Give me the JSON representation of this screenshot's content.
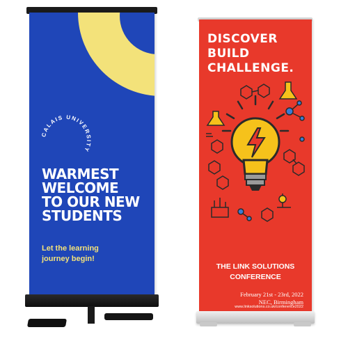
{
  "left_banner": {
    "university_ring": "CALAIS UNIVERSITY",
    "headline": [
      "WARMEST",
      "WELCOME",
      "TO OUR NEW",
      "STUDENTS"
    ],
    "subline": [
      "Let the learning",
      "journey begin!"
    ],
    "colors": {
      "background": "#1f46b8",
      "accent": "#f3e27a",
      "text": "#ffffff",
      "stand": "#1b1b1b"
    }
  },
  "right_banner": {
    "headline": [
      "DISCOVER",
      "BUILD",
      "CHALLENGE."
    ],
    "illustration": "lightbulb-with-science-icons",
    "conference_title": [
      "THE LINK SOLUTIONS",
      "CONFERENCE"
    ],
    "date_line": "February 21st - 23rd, 2022",
    "venue_line": "NEC, Birmingham",
    "url": "www.linksolutions.co.uk/conference2022",
    "colors": {
      "background": "#e8392b",
      "bulb": "#f6c21b",
      "text": "#ffffff",
      "stand": "#d8d8d8"
    }
  }
}
